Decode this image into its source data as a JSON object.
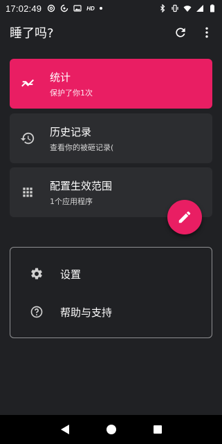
{
  "status_bar": {
    "time": "17:02:49",
    "hd_label": "HD",
    "icons": [
      "at-sign-icon",
      "sync-icon",
      "image-icon",
      "hd-icon",
      "dot-icon",
      "bluetooth-icon",
      "vibrate-icon",
      "wifi-icon",
      "signal-icon",
      "battery-icon"
    ]
  },
  "app_bar": {
    "title": "睡了吗?",
    "actions": [
      "refresh-icon",
      "more-vert-icon"
    ]
  },
  "cards": [
    {
      "title": "统计",
      "subtitle": "保护了你1次",
      "icon": "trend-icon"
    },
    {
      "title": "历史记录",
      "subtitle": "查看你的被砸记录(",
      "icon": "history-icon"
    },
    {
      "title": "配置生效范围",
      "subtitle": "1个应用程序",
      "icon": "apps-grid-icon"
    }
  ],
  "fab": {
    "icon": "edit-icon"
  },
  "menu": [
    {
      "label": "设置",
      "icon": "gear-icon"
    },
    {
      "label": "帮助与支持",
      "icon": "help-icon"
    }
  ],
  "nav_bar": {
    "icons": [
      "back-icon",
      "home-icon",
      "recents-icon"
    ]
  },
  "colors": {
    "accent": "#e91e63",
    "background": "#202124",
    "card": "#2c2d30",
    "outline": "#8f9092"
  }
}
